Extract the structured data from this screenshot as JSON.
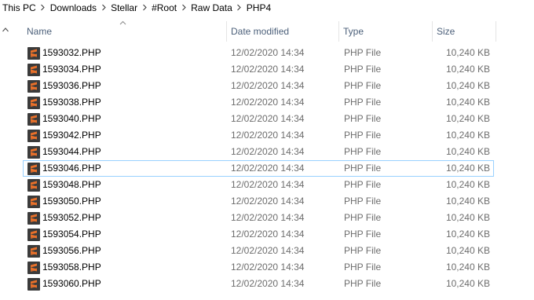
{
  "breadcrumb": [
    "This PC",
    "Downloads",
    "Stellar",
    "#Root",
    "Raw Data",
    "PHP4"
  ],
  "columns": {
    "name": "Name",
    "date": "Date modified",
    "type": "Type",
    "size": "Size"
  },
  "icon": "sublime-text-file-icon",
  "accent_color": "#e8702a",
  "files": [
    {
      "name": "1593032.PHP",
      "date": "12/02/2020 14:34",
      "type": "PHP File",
      "size": "10,240 KB"
    },
    {
      "name": "1593034.PHP",
      "date": "12/02/2020 14:34",
      "type": "PHP File",
      "size": "10,240 KB"
    },
    {
      "name": "1593036.PHP",
      "date": "12/02/2020 14:34",
      "type": "PHP File",
      "size": "10,240 KB"
    },
    {
      "name": "1593038.PHP",
      "date": "12/02/2020 14:34",
      "type": "PHP File",
      "size": "10,240 KB"
    },
    {
      "name": "1593040.PHP",
      "date": "12/02/2020 14:34",
      "type": "PHP File",
      "size": "10,240 KB"
    },
    {
      "name": "1593042.PHP",
      "date": "12/02/2020 14:34",
      "type": "PHP File",
      "size": "10,240 KB"
    },
    {
      "name": "1593044.PHP",
      "date": "12/02/2020 14:34",
      "type": "PHP File",
      "size": "10,240 KB"
    },
    {
      "name": "1593046.PHP",
      "date": "12/02/2020 14:34",
      "type": "PHP File",
      "size": "10,240 KB"
    },
    {
      "name": "1593048.PHP",
      "date": "12/02/2020 14:34",
      "type": "PHP File",
      "size": "10,240 KB"
    },
    {
      "name": "1593050.PHP",
      "date": "12/02/2020 14:34",
      "type": "PHP File",
      "size": "10,240 KB"
    },
    {
      "name": "1593052.PHP",
      "date": "12/02/2020 14:34",
      "type": "PHP File",
      "size": "10,240 KB"
    },
    {
      "name": "1593054.PHP",
      "date": "12/02/2020 14:34",
      "type": "PHP File",
      "size": "10,240 KB"
    },
    {
      "name": "1593056.PHP",
      "date": "12/02/2020 14:34",
      "type": "PHP File",
      "size": "10,240 KB"
    },
    {
      "name": "1593058.PHP",
      "date": "12/02/2020 14:34",
      "type": "PHP File",
      "size": "10,240 KB"
    },
    {
      "name": "1593060.PHP",
      "date": "12/02/2020 14:34",
      "type": "PHP File",
      "size": "10,240 KB"
    }
  ],
  "focused_index": 7
}
